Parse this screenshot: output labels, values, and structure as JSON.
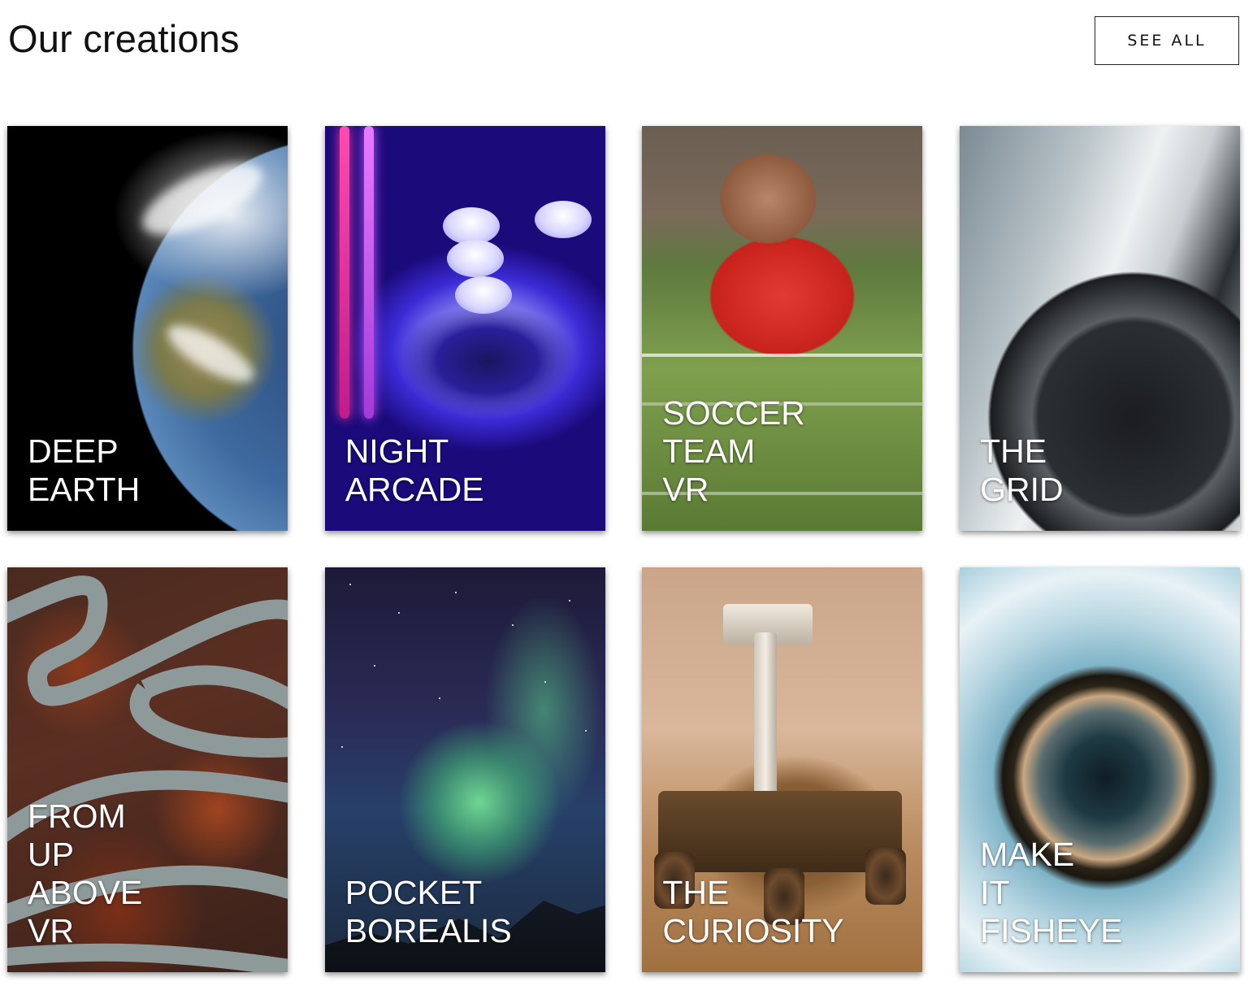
{
  "header": {
    "title": "Our creations",
    "see_all_label": "SEE ALL"
  },
  "cards": [
    {
      "title": "DEEP\nEARTH"
    },
    {
      "title": "NIGHT\nARCADE"
    },
    {
      "title": "SOCCER\nTEAM\nVR"
    },
    {
      "title": "THE\nGRID"
    },
    {
      "title": "FROM\nUP\nABOVE\nVR"
    },
    {
      "title": "POCKET\nBOREALIS"
    },
    {
      "title": "THE\nCURIOSITY"
    },
    {
      "title": "MAKE\nIT\nFISHEYE"
    }
  ]
}
